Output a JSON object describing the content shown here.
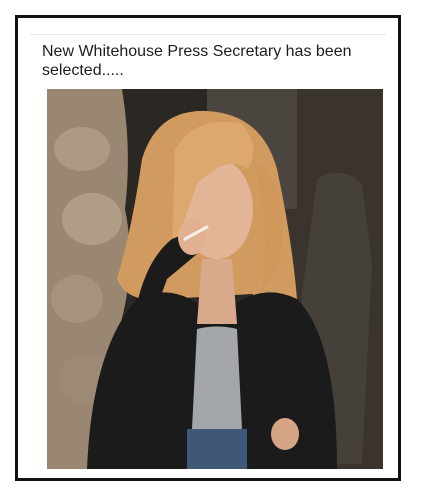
{
  "post": {
    "caption": "New Whitehouse Press Secretary has been selected....."
  },
  "photo": {
    "subject": "woman-with-cigarette",
    "palette": {
      "stone": "#a08e78",
      "background_dark": "#2a2622",
      "hair": "#d9a46a",
      "skin": "#e3b596",
      "jacket": "#1a1a1a",
      "shirt": "#9fa3a6",
      "denim": "#3d5677"
    }
  }
}
